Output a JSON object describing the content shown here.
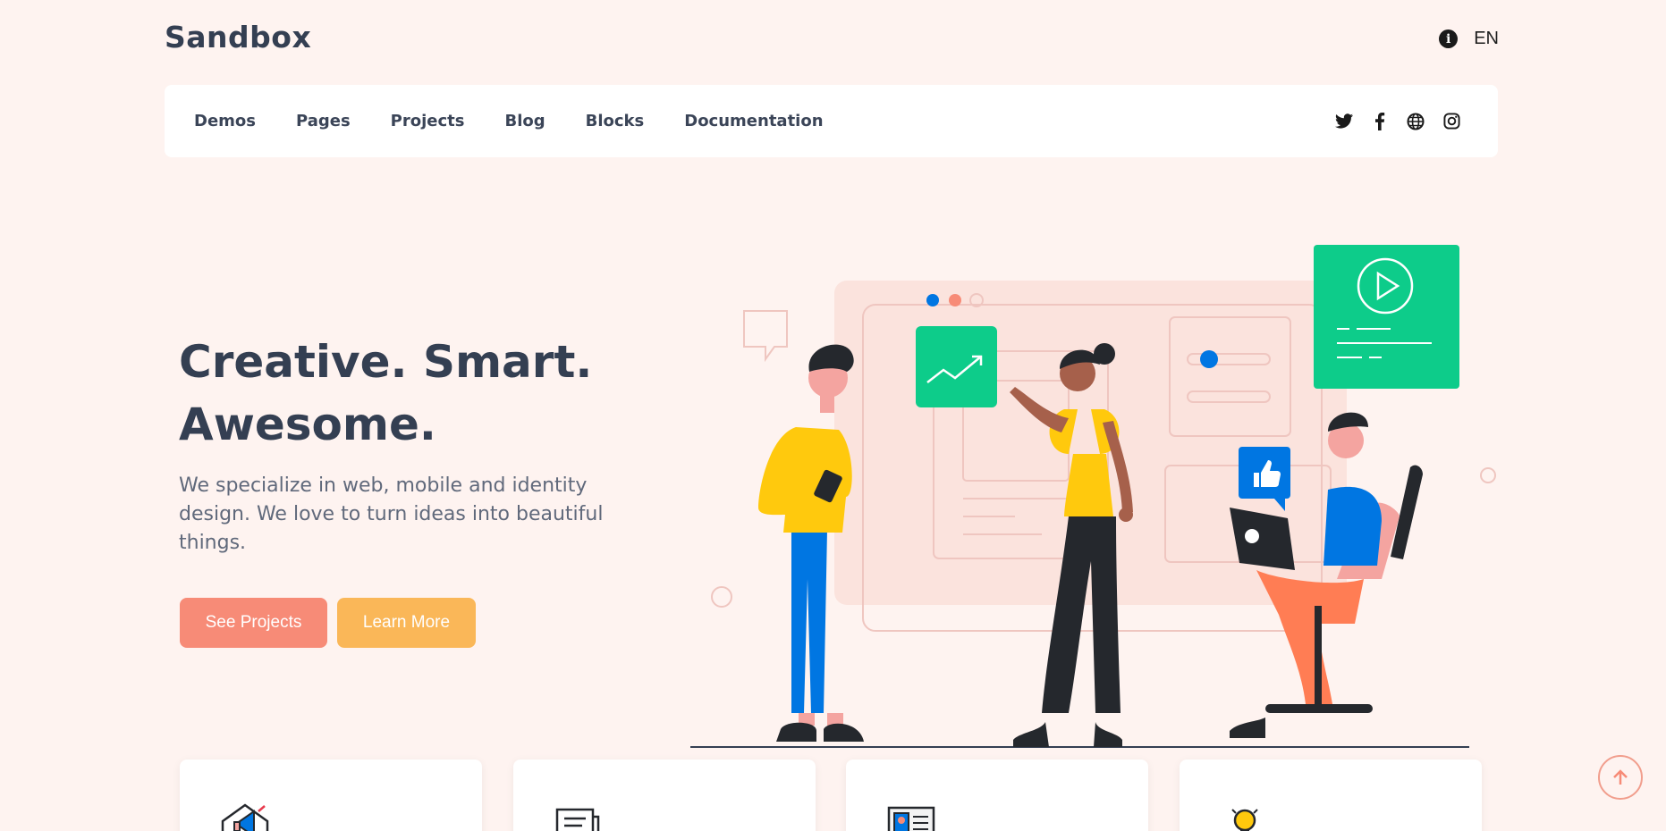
{
  "brand": {
    "logo_text": "Sandbox"
  },
  "topbar": {
    "language": "EN",
    "info_icon": "info-icon"
  },
  "nav": {
    "links": [
      "Demos",
      "Pages",
      "Projects",
      "Blog",
      "Blocks",
      "Documentation"
    ],
    "socials": [
      "twitter-icon",
      "facebook-icon",
      "globe-icon",
      "instagram-icon"
    ]
  },
  "hero": {
    "title_line1": "Creative. Smart.",
    "title_line2": "Awesome.",
    "description": "We specialize in web, mobile and identity design. We love to turn ideas into beautiful things.",
    "primary_button": "See Projects",
    "secondary_button": "Learn More"
  },
  "colors": {
    "background": "#fef3f0",
    "primary": "#f78b77",
    "secondary": "#fab758",
    "green": "#0dcc8a",
    "blue": "#0076e2",
    "heading": "#343f52"
  },
  "feature_cards": [
    {
      "icon": "megaphone-icon"
    },
    {
      "icon": "chat-icon"
    },
    {
      "icon": "id-card-icon"
    },
    {
      "icon": "lightbulb-icon"
    }
  ]
}
